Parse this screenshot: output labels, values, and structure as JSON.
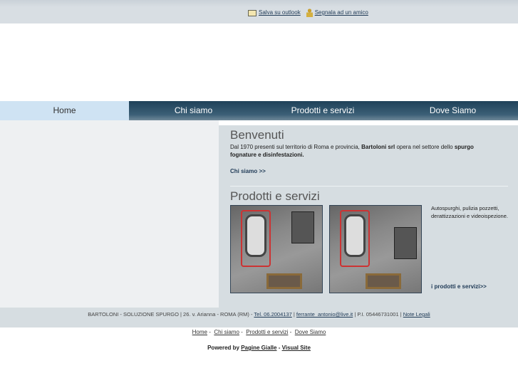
{
  "top": {
    "save_outlook": "Salva su outlook",
    "recommend": "Segnala ad un amico"
  },
  "nav": [
    "Home",
    "Chi siamo",
    "Prodotti e servizi",
    "Dove Siamo"
  ],
  "welcome": {
    "title": "Benvenuti",
    "text1": "Dal 1970 presenti sul territorio di Roma e provincia, ",
    "bold1": "Bartoloni srl",
    "text2": " opera nel settore dello ",
    "bold2": "spurgo fognature e disinfestazioni.",
    "more": "Chi siamo >>"
  },
  "products": {
    "title": "Prodotti e servizi",
    "desc": "Autospurghi, pulizia pozzetti, derattizzazioni e videoispezione.",
    "more": "i prodotti e servizi>>"
  },
  "footer": {
    "company": "BARTOLONI - SOLUZIONE SPURGO | 26. v. Arianna - ROMA (RM) - ",
    "tel": "Tel. 06.2004137",
    "sep1": " | ",
    "email": "ferrante_antonio@live.it",
    "piva": " | P.I. 05446731001 | ",
    "legal": "Note Legali"
  },
  "footnav": [
    "Home",
    "Chi siamo",
    "Prodotti e servizi",
    "Dove Siamo"
  ],
  "powered": {
    "prefix": "Powered by ",
    "pg": "Pagine Gialle",
    "sep": " - ",
    "vs": "Visual Site"
  }
}
